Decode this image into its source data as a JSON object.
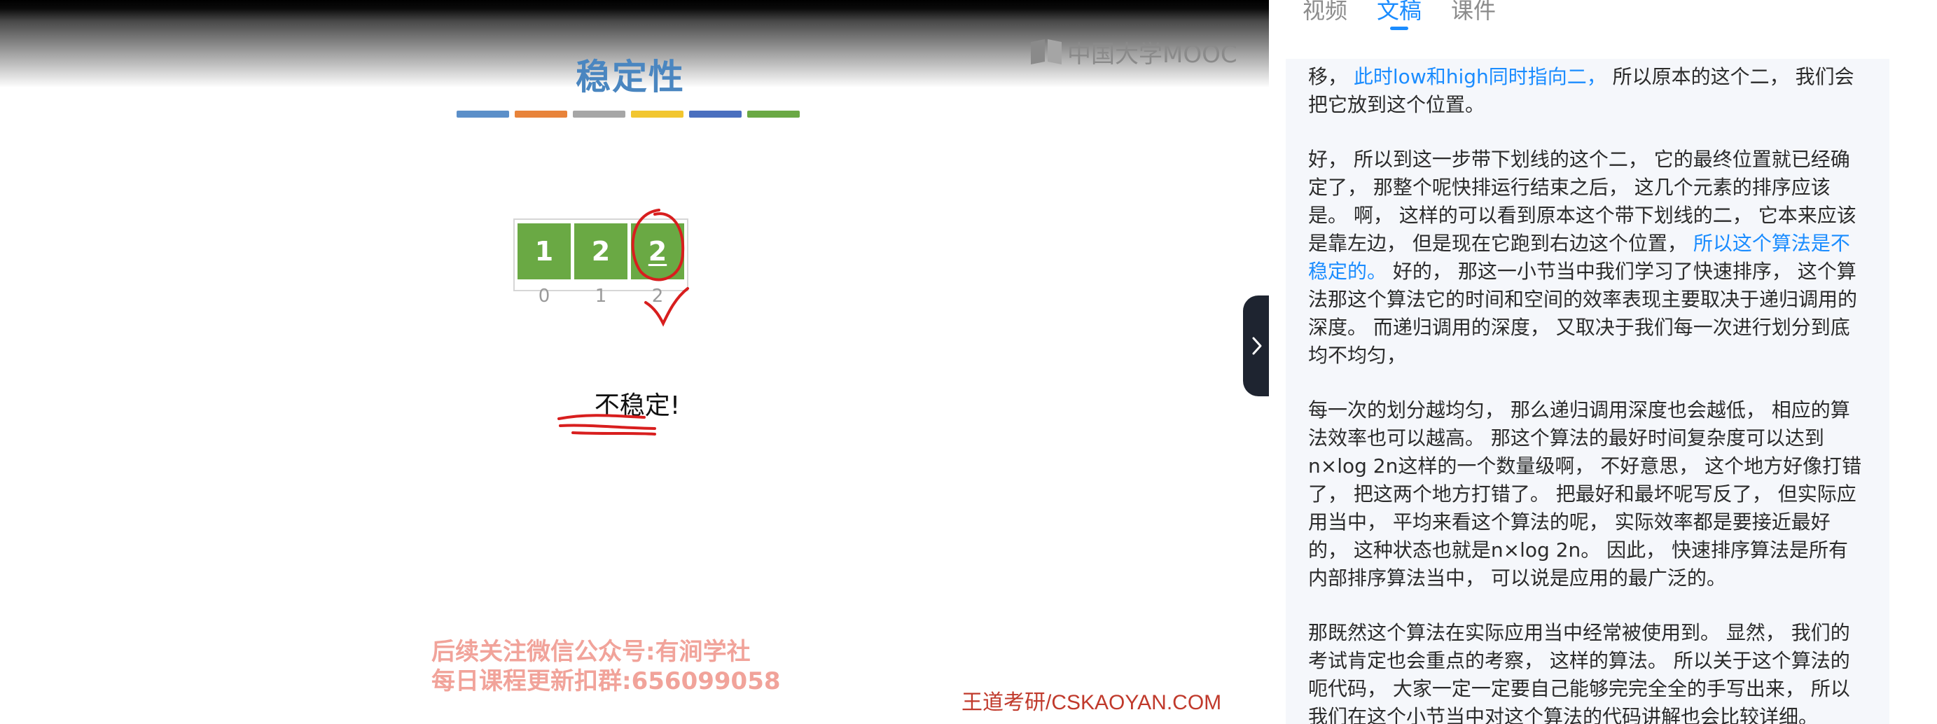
{
  "slide": {
    "title": "稳定性",
    "color_bar_colors": [
      "#5b8fc9",
      "#e8833a",
      "#a6a6a6",
      "#f2c62f",
      "#4a6fbf",
      "#6aa944"
    ],
    "logo_text": "中国大学MOOC",
    "array_cells": [
      "1",
      "2",
      "2"
    ],
    "array_indices": [
      "0",
      "1",
      "2"
    ],
    "cell_color": "#6aa944",
    "verdict": "不稳定!",
    "annotation_color": "#d81e1e",
    "watermark_lines": [
      "后续关注微信公众号:有涧学社",
      "每日课程更新扣群:656099058"
    ],
    "credit": "王道考研/CSKAOYAN.COM"
  },
  "panel": {
    "tabs": [
      {
        "label": "视频",
        "active": false
      },
      {
        "label": "文稿",
        "active": true
      },
      {
        "label": "课件",
        "active": false
      }
    ],
    "accent_color": "#1a8cff",
    "paragraphs": [
      [
        {
          "text": "移，  ",
          "hl": false
        },
        {
          "text": "此时low和high同时指向二，",
          "hl": true
        },
        {
          "text": "  所以原本的这个二，  我们会把它放到这个位置。",
          "hl": false
        }
      ],
      [
        {
          "text": "好，  所以到这一步带下划线的这个二，  它的最终位置就已经确定了，  那整个呢快排运行结束之后，  这几个元素的排序应该是。  啊，  这样的可以看到原本这个带下划线的二，  它本来应该是靠左边，  但是现在它跑到右边这个位置，  ",
          "hl": false
        },
        {
          "text": "所以这个算法是不稳定的。",
          "hl": true
        },
        {
          "text": "  好的，  那这一小节当中我们学习了快速排序，  这个算法那这个算法它的时间和空间的效率表现主要取决于递归调用的深度。  而递归调用的深度，  又取决于我们每一次进行划分到底均不均匀，",
          "hl": false
        }
      ],
      [
        {
          "text": "每一次的划分越均匀，  那么递归调用深度也会越低，  相应的算法效率也可以越高。  那这个算法的最好时间复杂度可以达到n×log 2n这样的一个数量级啊，  不好意思，  这个地方好像打错了，  把这两个地方打错了。  把最好和最坏呢写反了，  但实际应用当中，  平均来看这个算法的呢，  实际效率都是要接近最好的，  这种状态也就是n×log 2n。  因此，  快速排序算法是所有内部排序算法当中，  可以说是应用的最广泛的。",
          "hl": false
        }
      ],
      [
        {
          "text": "那既然这个算法在实际应用当中经常被使用到。  显然，  我们的考试肯定也会重点的考察，  这样的算法。  所以关于这个算法的呃代码，  大家一定一定要自己能够完完全全的手写出来，  所以我们在这个小节当中对这个算法的代码讲解也会比较详细。",
          "hl": false
        }
      ]
    ]
  }
}
